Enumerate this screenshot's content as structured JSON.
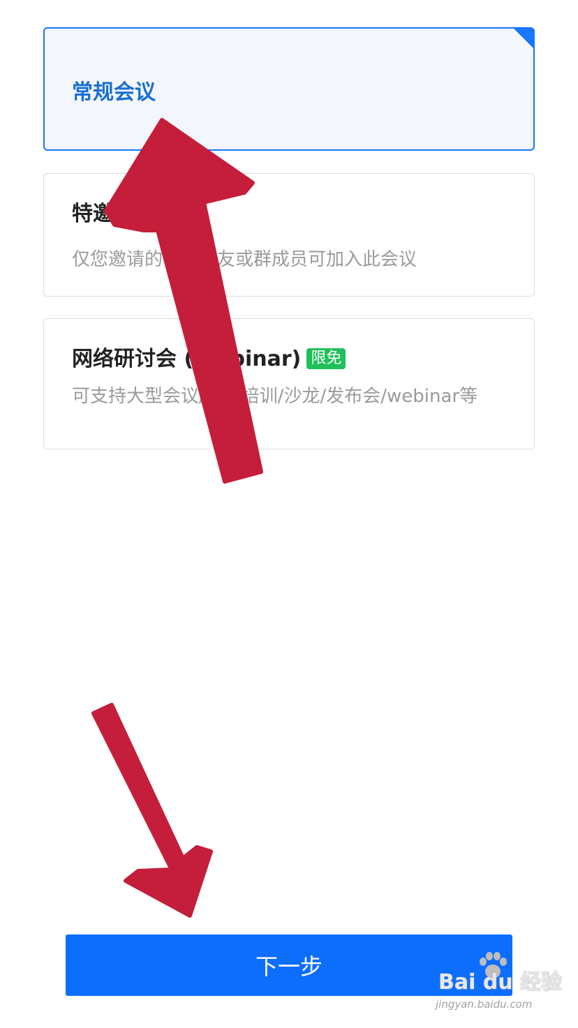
{
  "options": [
    {
      "title": "常规会议",
      "description": "",
      "selected": true
    },
    {
      "title": "特邀会议",
      "description": "仅您邀请的微信好友或群成员可加入此会议",
      "selected": false
    },
    {
      "title": "网络研讨会 (Webinar)",
      "badge": "限免",
      "description": "可支持大型会议/企业培训/沙龙/发布会/webinar等",
      "selected": false
    }
  ],
  "next_button": {
    "label": "下一步"
  },
  "watermark": {
    "brand": "Bai du 经验",
    "url": "jingyan.baidu.com"
  },
  "colors": {
    "accent": "#1677ff",
    "button": "#0d6efd",
    "badge": "#1fbf5a",
    "annotation_arrow": "#c41e3a"
  },
  "icons": {
    "selected_corner": "selected-corner-flag-icon",
    "arrow_up": "arrow-up-annotation-icon",
    "arrow_down": "arrow-down-annotation-icon",
    "watermark_logo": "baidu-paw-icon"
  }
}
